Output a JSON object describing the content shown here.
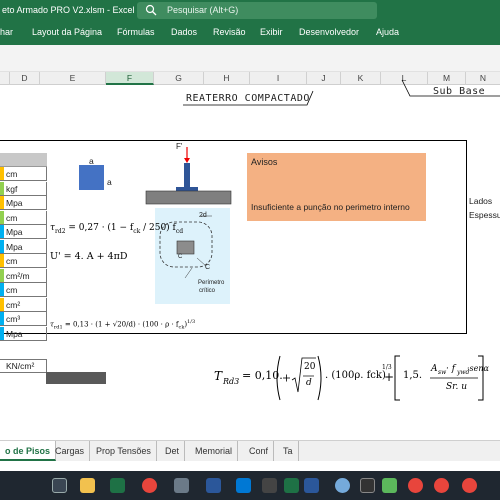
{
  "window": {
    "title": "eto Armado PRO V2.xlsm  -  Excel"
  },
  "search": {
    "placeholder": "Pesquisar (Alt+G)"
  },
  "ribbon": {
    "tabs": [
      "har",
      "Layout da Página",
      "Fórmulas",
      "Dados",
      "Revisão",
      "Exibir",
      "Desenvolvedor",
      "Ajuda"
    ]
  },
  "columns": [
    "D",
    "E",
    "F",
    "G",
    "H",
    "I",
    "J",
    "K",
    "L",
    "M",
    "N"
  ],
  "sheet": {
    "title_reaterro": "REATERRO  COMPACTADO",
    "title_subbase": "Sub  Base",
    "units": [
      "cm",
      "kgf",
      "Mpa",
      "cm",
      "Mpa",
      "Mpa",
      "cm",
      "cm²/m",
      "cm",
      "cm²",
      "cm³",
      "Mpa"
    ],
    "unit_markers": [
      "0",
      "0",
      "0",
      "0",
      "0",
      "0",
      "0",
      "0",
      "0",
      "0",
      "0",
      "0"
    ],
    "square_label_a_top": "a",
    "square_label_a_side": "a",
    "avisos_title": "Avisos",
    "avisos_msg": "Insuficiente a punção no perimetro interno",
    "side_lados": "Lados",
    "side_espessura": "Espessu",
    "f_label": "F'",
    "label_2d": "2d",
    "label_c1": "C",
    "label_c2": "C",
    "label_perim1": "Perímetro",
    "label_perim2": "crítico",
    "kn_unit": "KN/cm²",
    "formula_trd2": "τ",
    "formula_trd2_sub": "rd2",
    "formula_trd2_rest": "= 0,27 · (1 − f",
    "formula_trd2_ck": "ck",
    "formula_trd2_end": " / 250) f",
    "formula_trd2_cd": "cd",
    "formula_u": "U' = 4. A + 4πD",
    "formula_trd1": "τ",
    "formula_trd1_sub": "rd1",
    "formula_trd1_rest": "= 0,13 · (1 + √20/d) · (100 · ρ · f",
    "formula_trd1_ck": "ck",
    "formula_trd1_end": ")",
    "formula_trd1_exp": "1/3",
    "formula_big": "T",
    "formula_big_sub": "Rd3",
    "formula_big_rest": "= 0,10.",
    "formula_big_20": "20",
    "formula_big_d": "d",
    "formula_big_mid": ". (100ρ. fck)",
    "formula_big_exp": "1/3",
    "formula_big_num": "A",
    "formula_big_num2": "sw",
    "formula_big_num3": "· f",
    "formula_big_num4": "ywd",
    "formula_big_num5": "·senα",
    "formula_big_den": "Sr. u",
    "formula_big_15": "1,5.",
    "formula_big_plus": "+"
  },
  "sheet_tabs": [
    "o de Pisos",
    "Cargas",
    "Prop Tensões",
    "Det",
    "Memorial",
    "Conf",
    "Ta"
  ],
  "active_tab": "o de Pisos",
  "colors": {
    "excel_green": "#217346",
    "avisos": "#f4b183",
    "square_blue": "#4472c4"
  },
  "taskbar_icons": [
    "task-view-icon",
    "explorer-icon",
    "excel-icon",
    "chrome-icon",
    "settings-icon",
    "store-icon",
    "photos-icon",
    "calc-icon",
    "excel-icon-2",
    "word-icon",
    "rstudio-icon",
    "app-icon",
    "camtasia-icon",
    "chrome-icon-2",
    "chrome-icon-3",
    "chrome-icon-4"
  ]
}
